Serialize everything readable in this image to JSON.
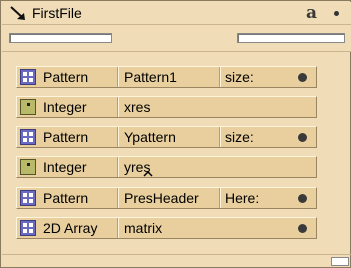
{
  "window": {
    "title": "FirstFile",
    "a_button_label": "a"
  },
  "icons": {
    "title": "arrow-icon",
    "pattern": "pattern-grid-icon",
    "integer": "integer-icon",
    "array": "array-grid-icon"
  },
  "rows": [
    {
      "type": "Pattern",
      "name": "Pattern1",
      "extra": "size:",
      "has_dot": true
    },
    {
      "type": "Integer",
      "name": "xres",
      "extra": "",
      "has_dot": false
    },
    {
      "type": "Pattern",
      "name": "Ypattern",
      "extra": "size:",
      "has_dot": true
    },
    {
      "type": "Integer",
      "name": "yres",
      "extra": "",
      "has_dot": false
    },
    {
      "type": "Pattern",
      "name": "PresHeader",
      "extra": "Here:",
      "has_dot": true
    },
    {
      "type": "2D Array",
      "name": "matrix",
      "extra": "",
      "has_dot": true
    }
  ],
  "colors": {
    "window_bg": "#f0dcb6",
    "row_bg": "#e8cf9d",
    "pattern_icon": "#6a6ac2",
    "integer_icon": "#b9b96a"
  }
}
